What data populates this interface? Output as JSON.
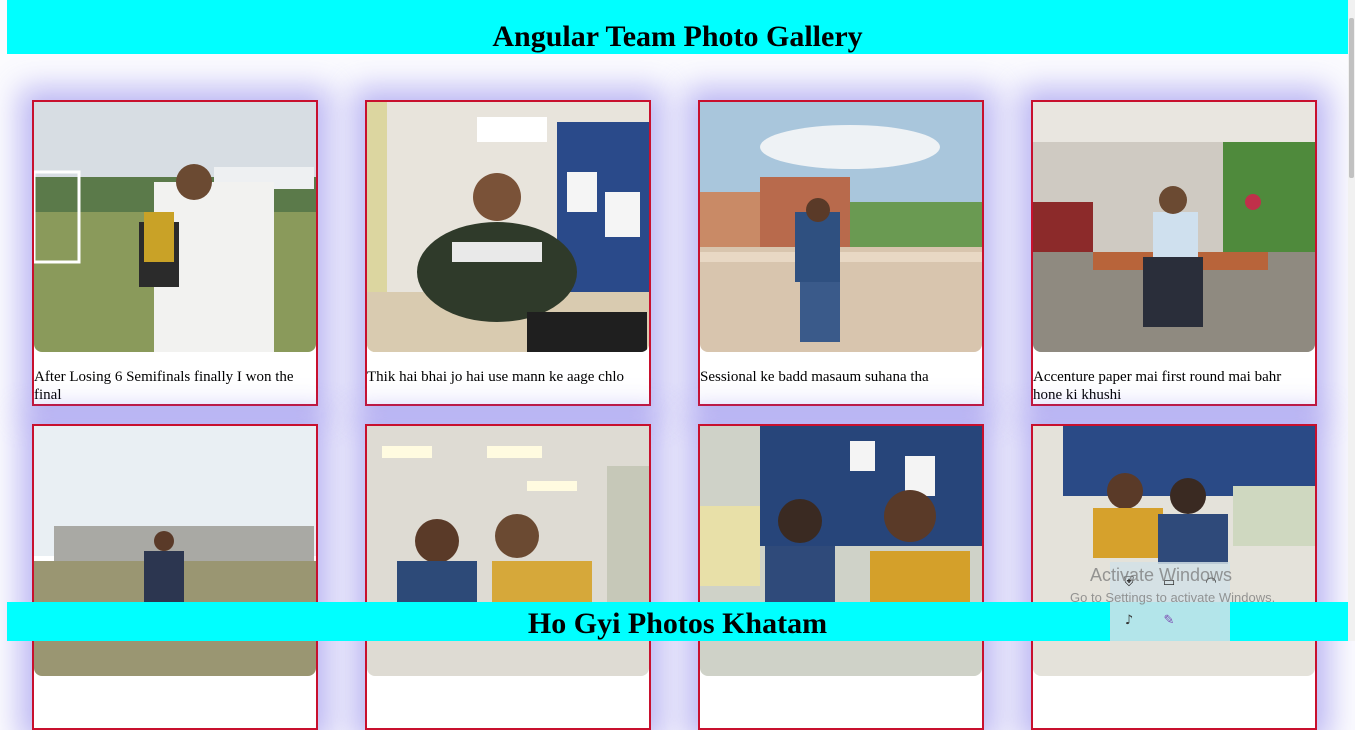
{
  "header": {
    "title": "Angular Team Photo Gallery"
  },
  "footer": {
    "text": "Ho Gyi Photos Khatam"
  },
  "gallery": {
    "cards": [
      {
        "caption": "After Losing 6 Semifinals finally I won the final",
        "photo": "cricket-trophy-photo"
      },
      {
        "caption": "Thik hai bhai jo hai use mann ke aage chlo",
        "photo": "office-desk-photo"
      },
      {
        "caption": "Sessional ke badd masaum suhana tha",
        "photo": "balcony-sky-photo"
      },
      {
        "caption": "Accenture paper mai first round mai bahr hone ki khushi",
        "photo": "campus-bench-photo"
      },
      {
        "caption": "",
        "photo": "field-buildings-photo"
      },
      {
        "caption": "",
        "photo": "office-selfie-photo"
      },
      {
        "caption": "",
        "photo": "cubicle-selfie-photo"
      },
      {
        "caption": "",
        "photo": "workspace-duo-photo"
      }
    ]
  },
  "watermark": {
    "line1": "Activate Windows",
    "line2": "Go to Settings to activate Windows."
  },
  "colors": {
    "header_bg": "#00ffff",
    "card_border": "#c8102e",
    "shadow": "#6e64e6"
  }
}
